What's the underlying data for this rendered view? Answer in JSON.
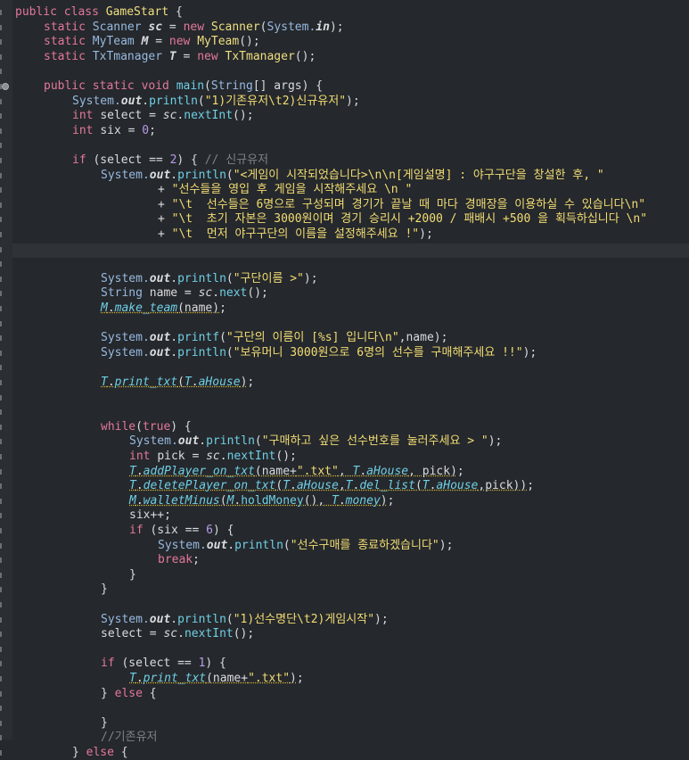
{
  "theme": {
    "background": "#25282c",
    "keyword": "#e2789b",
    "type": "#97b9e0",
    "class": "#f0df82",
    "method": "#6fcfe6",
    "string": "#f2dd74",
    "comment": "#7e8286",
    "number": "#b79be6",
    "plain": "#d9dcdf"
  },
  "lines": [
    {
      "indent": 0,
      "tokens": [
        {
          "t": "public class ",
          "c": "kw"
        },
        {
          "t": "GameStart ",
          "c": "cls"
        },
        {
          "t": "{",
          "c": "pl"
        }
      ]
    },
    {
      "indent": 1,
      "tokens": [
        {
          "t": "static ",
          "c": "kw"
        },
        {
          "t": "Scanner ",
          "c": "ty"
        },
        {
          "t": "sc",
          "c": "pl",
          "f": "it bd"
        },
        {
          "t": " = ",
          "c": "pl"
        },
        {
          "t": "new ",
          "c": "kw"
        },
        {
          "t": "Scanner",
          "c": "cls"
        },
        {
          "t": "(",
          "c": "pl"
        },
        {
          "t": "System.",
          "c": "ty"
        },
        {
          "t": "in",
          "c": "pl",
          "f": "it bd"
        },
        {
          "t": ");",
          "c": "pl"
        }
      ]
    },
    {
      "indent": 1,
      "tokens": [
        {
          "t": "static ",
          "c": "kw"
        },
        {
          "t": "MyTeam ",
          "c": "ty"
        },
        {
          "t": "M",
          "c": "pl",
          "f": "it bd"
        },
        {
          "t": " = ",
          "c": "pl"
        },
        {
          "t": "new ",
          "c": "kw"
        },
        {
          "t": "MyTeam",
          "c": "cls"
        },
        {
          "t": "();",
          "c": "pl"
        }
      ]
    },
    {
      "indent": 1,
      "tokens": [
        {
          "t": "static ",
          "c": "kw"
        },
        {
          "t": "TxTmanager ",
          "c": "ty"
        },
        {
          "t": "T",
          "c": "pl",
          "f": "it bd"
        },
        {
          "t": " = ",
          "c": "pl"
        },
        {
          "t": "new ",
          "c": "kw"
        },
        {
          "t": "TxTmanager",
          "c": "cls"
        },
        {
          "t": "();",
          "c": "pl"
        }
      ]
    },
    {
      "indent": 0,
      "tokens": []
    },
    {
      "indent": 1,
      "tokens": [
        {
          "t": "public static void ",
          "c": "kw"
        },
        {
          "t": "main",
          "c": "fn"
        },
        {
          "t": "(",
          "c": "pl"
        },
        {
          "t": "String",
          "c": "ty"
        },
        {
          "t": "[] args) {",
          "c": "pl"
        }
      ]
    },
    {
      "indent": 2,
      "tokens": [
        {
          "t": "System.",
          "c": "ty"
        },
        {
          "t": "out",
          "c": "pl",
          "f": "it bd"
        },
        {
          "t": ".",
          "c": "pl"
        },
        {
          "t": "println",
          "c": "fn"
        },
        {
          "t": "(",
          "c": "pl"
        },
        {
          "t": "\"1)기존유저\\t2)신규유저\"",
          "c": "st"
        },
        {
          "t": ");",
          "c": "pl"
        }
      ]
    },
    {
      "indent": 2,
      "tokens": [
        {
          "t": "int ",
          "c": "kw"
        },
        {
          "t": "select = ",
          "c": "pl"
        },
        {
          "t": "sc",
          "c": "pl",
          "f": "it"
        },
        {
          "t": ".",
          "c": "pl"
        },
        {
          "t": "nextInt",
          "c": "fn"
        },
        {
          "t": "();",
          "c": "pl"
        }
      ]
    },
    {
      "indent": 2,
      "tokens": [
        {
          "t": "int ",
          "c": "kw"
        },
        {
          "t": "six = ",
          "c": "pl"
        },
        {
          "t": "0",
          "c": "nm"
        },
        {
          "t": ";",
          "c": "pl"
        }
      ]
    },
    {
      "indent": 0,
      "tokens": []
    },
    {
      "indent": 2,
      "tokens": [
        {
          "t": "if ",
          "c": "kw"
        },
        {
          "t": "(select == ",
          "c": "pl"
        },
        {
          "t": "2",
          "c": "nm"
        },
        {
          "t": ") { ",
          "c": "pl"
        },
        {
          "t": "// 신규유저",
          "c": "cm"
        }
      ]
    },
    {
      "indent": 3,
      "tokens": [
        {
          "t": "System.",
          "c": "ty"
        },
        {
          "t": "out",
          "c": "pl",
          "f": "it bd"
        },
        {
          "t": ".",
          "c": "pl"
        },
        {
          "t": "println",
          "c": "fn"
        },
        {
          "t": "(",
          "c": "pl"
        },
        {
          "t": "\"<게임이 시작되었습니다>\\n\\n[게임설명] : 야구구단을 창설한 후, \"",
          "c": "st"
        }
      ]
    },
    {
      "indent": 5,
      "tokens": [
        {
          "t": "+ ",
          "c": "pl"
        },
        {
          "t": "\"선수들을 영입 후 게임을 시작해주세요 \\n \"",
          "c": "st"
        }
      ]
    },
    {
      "indent": 5,
      "tokens": [
        {
          "t": "+ ",
          "c": "pl"
        },
        {
          "t": "\"\\t  선수들은 6명으로 구성되며 경기가 끝날 때 마다 경매장을 이용하실 수 있습니다\\n\"",
          "c": "st"
        }
      ]
    },
    {
      "indent": 5,
      "tokens": [
        {
          "t": "+ ",
          "c": "pl"
        },
        {
          "t": "\"\\t  초기 자본은 3000원이며 경기 승리시 +2000 / 패배시 +500 을 획득하십니다 \\n\"",
          "c": "st"
        }
      ]
    },
    {
      "indent": 5,
      "tokens": [
        {
          "t": "+ ",
          "c": "pl"
        },
        {
          "t": "\"\\t  먼저 야구구단의 이름을 설정해주세요 !\"",
          "c": "st"
        },
        {
          "t": ");",
          "c": "pl"
        }
      ]
    },
    {
      "indent": 0,
      "tokens": []
    },
    {
      "indent": 0,
      "tokens": []
    },
    {
      "indent": 3,
      "tokens": [
        {
          "t": "System.",
          "c": "ty"
        },
        {
          "t": "out",
          "c": "pl",
          "f": "it bd"
        },
        {
          "t": ".",
          "c": "pl"
        },
        {
          "t": "println",
          "c": "fn"
        },
        {
          "t": "(",
          "c": "pl"
        },
        {
          "t": "\"구단이름 >\"",
          "c": "st"
        },
        {
          "t": ");",
          "c": "pl"
        }
      ]
    },
    {
      "indent": 3,
      "tokens": [
        {
          "t": "String ",
          "c": "ty"
        },
        {
          "t": "name = ",
          "c": "pl"
        },
        {
          "t": "sc",
          "c": "pl",
          "f": "it"
        },
        {
          "t": ".",
          "c": "pl"
        },
        {
          "t": "next",
          "c": "fn"
        },
        {
          "t": "();",
          "c": "pl"
        }
      ]
    },
    {
      "indent": 3,
      "tokens": [
        {
          "t": "M",
          "c": "fn",
          "f": "it ul"
        },
        {
          "t": ".",
          "c": "pl",
          "f": "ul"
        },
        {
          "t": "make_team",
          "c": "fn",
          "f": "it ul"
        },
        {
          "t": "(name)",
          "c": "pl",
          "f": "ul"
        },
        {
          "t": ";",
          "c": "pl"
        }
      ]
    },
    {
      "indent": 0,
      "tokens": []
    },
    {
      "indent": 3,
      "tokens": [
        {
          "t": "System.",
          "c": "ty"
        },
        {
          "t": "out",
          "c": "pl",
          "f": "it bd"
        },
        {
          "t": ".",
          "c": "pl"
        },
        {
          "t": "printf",
          "c": "fn"
        },
        {
          "t": "(",
          "c": "pl"
        },
        {
          "t": "\"구단의 이름이 [%s] 입니다\\n\"",
          "c": "st"
        },
        {
          "t": ",name);",
          "c": "pl"
        }
      ]
    },
    {
      "indent": 3,
      "tokens": [
        {
          "t": "System.",
          "c": "ty"
        },
        {
          "t": "out",
          "c": "pl",
          "f": "it bd"
        },
        {
          "t": ".",
          "c": "pl"
        },
        {
          "t": "println",
          "c": "fn"
        },
        {
          "t": "(",
          "c": "pl"
        },
        {
          "t": "\"보유머니 3000원으로 6명의 선수를 구매해주세요 !!\"",
          "c": "st"
        },
        {
          "t": ");",
          "c": "pl"
        }
      ]
    },
    {
      "indent": 0,
      "tokens": []
    },
    {
      "indent": 3,
      "tokens": [
        {
          "t": "T",
          "c": "fn",
          "f": "it ul"
        },
        {
          "t": ".",
          "c": "pl",
          "f": "ul"
        },
        {
          "t": "print_txt",
          "c": "fn",
          "f": "it ul"
        },
        {
          "t": "(",
          "c": "pl",
          "f": "ul"
        },
        {
          "t": "T",
          "c": "fn",
          "f": "it ul"
        },
        {
          "t": ".",
          "c": "pl",
          "f": "ul"
        },
        {
          "t": "aHouse",
          "c": "fn",
          "f": "it ul"
        },
        {
          "t": ")",
          "c": "pl",
          "f": "ul"
        },
        {
          "t": ";",
          "c": "pl"
        }
      ]
    },
    {
      "indent": 0,
      "tokens": []
    },
    {
      "indent": 0,
      "tokens": []
    },
    {
      "indent": 3,
      "tokens": [
        {
          "t": "while",
          "c": "kw"
        },
        {
          "t": "(",
          "c": "pl"
        },
        {
          "t": "true",
          "c": "kw"
        },
        {
          "t": ") {",
          "c": "pl"
        }
      ]
    },
    {
      "indent": 4,
      "tokens": [
        {
          "t": "System.",
          "c": "ty"
        },
        {
          "t": "out",
          "c": "pl",
          "f": "it bd"
        },
        {
          "t": ".",
          "c": "pl"
        },
        {
          "t": "println",
          "c": "fn"
        },
        {
          "t": "(",
          "c": "pl"
        },
        {
          "t": "\"구매하고 싶은 선수번호를 눌러주세요 > \"",
          "c": "st"
        },
        {
          "t": ");",
          "c": "pl"
        }
      ]
    },
    {
      "indent": 4,
      "tokens": [
        {
          "t": "int ",
          "c": "kw"
        },
        {
          "t": "pick = ",
          "c": "pl"
        },
        {
          "t": "sc",
          "c": "pl",
          "f": "it"
        },
        {
          "t": ".",
          "c": "pl"
        },
        {
          "t": "nextInt",
          "c": "fn"
        },
        {
          "t": "();",
          "c": "pl"
        }
      ]
    },
    {
      "indent": 4,
      "tokens": [
        {
          "t": "T",
          "c": "fn",
          "f": "it ul"
        },
        {
          "t": ".",
          "c": "pl",
          "f": "ul"
        },
        {
          "t": "addPlayer_on_txt",
          "c": "fn",
          "f": "it ul"
        },
        {
          "t": "(name+",
          "c": "pl",
          "f": "ul"
        },
        {
          "t": "\".txt\"",
          "c": "st",
          "f": "ul"
        },
        {
          "t": ", ",
          "c": "pl",
          "f": "ul"
        },
        {
          "t": "T",
          "c": "fn",
          "f": "it ul"
        },
        {
          "t": ".",
          "c": "pl",
          "f": "ul"
        },
        {
          "t": "aHouse",
          "c": "fn",
          "f": "it ul"
        },
        {
          "t": ", pick)",
          "c": "pl",
          "f": "ul"
        },
        {
          "t": ";",
          "c": "pl"
        }
      ]
    },
    {
      "indent": 4,
      "tokens": [
        {
          "t": "T",
          "c": "fn",
          "f": "it ul"
        },
        {
          "t": ".",
          "c": "pl",
          "f": "ul"
        },
        {
          "t": "deletePlayer_on_txt",
          "c": "fn",
          "f": "it ul"
        },
        {
          "t": "(",
          "c": "pl",
          "f": "ul"
        },
        {
          "t": "T",
          "c": "fn",
          "f": "it ul"
        },
        {
          "t": ".",
          "c": "pl",
          "f": "ul"
        },
        {
          "t": "aHouse",
          "c": "fn",
          "f": "it ul"
        },
        {
          "t": ",",
          "c": "pl",
          "f": "ul"
        },
        {
          "t": "T",
          "c": "fn",
          "f": "it ul"
        },
        {
          "t": ".",
          "c": "pl",
          "f": "ul"
        },
        {
          "t": "del_list",
          "c": "fn",
          "f": "it ul"
        },
        {
          "t": "(",
          "c": "pl",
          "f": "ul"
        },
        {
          "t": "T",
          "c": "fn",
          "f": "it ul"
        },
        {
          "t": ".",
          "c": "pl",
          "f": "ul"
        },
        {
          "t": "aHouse",
          "c": "fn",
          "f": "it ul"
        },
        {
          "t": ",pick))",
          "c": "pl",
          "f": "ul"
        },
        {
          "t": ";",
          "c": "pl"
        }
      ]
    },
    {
      "indent": 4,
      "tokens": [
        {
          "t": "M",
          "c": "fn",
          "f": "it ul"
        },
        {
          "t": ".",
          "c": "pl",
          "f": "ul"
        },
        {
          "t": "walletMinus",
          "c": "fn",
          "f": "it ul"
        },
        {
          "t": "(",
          "c": "pl",
          "f": "ul"
        },
        {
          "t": "M",
          "c": "fn",
          "f": "it ul"
        },
        {
          "t": ".",
          "c": "pl",
          "f": "ul"
        },
        {
          "t": "holdMoney",
          "c": "fn",
          "f": "ul"
        },
        {
          "t": "(), ",
          "c": "pl",
          "f": "ul"
        },
        {
          "t": "T",
          "c": "fn",
          "f": "it ul"
        },
        {
          "t": ".",
          "c": "pl",
          "f": "ul"
        },
        {
          "t": "money",
          "c": "fn",
          "f": "it ul"
        },
        {
          "t": ")",
          "c": "pl",
          "f": "ul"
        },
        {
          "t": ";",
          "c": "pl"
        }
      ]
    },
    {
      "indent": 4,
      "tokens": [
        {
          "t": "six++;",
          "c": "pl"
        }
      ]
    },
    {
      "indent": 4,
      "tokens": [
        {
          "t": "if ",
          "c": "kw"
        },
        {
          "t": "(six == ",
          "c": "pl"
        },
        {
          "t": "6",
          "c": "nm"
        },
        {
          "t": ") {",
          "c": "pl"
        }
      ]
    },
    {
      "indent": 5,
      "tokens": [
        {
          "t": "System.",
          "c": "ty"
        },
        {
          "t": "out",
          "c": "pl",
          "f": "it bd"
        },
        {
          "t": ".",
          "c": "pl"
        },
        {
          "t": "println",
          "c": "fn"
        },
        {
          "t": "(",
          "c": "pl"
        },
        {
          "t": "\"선수구매를 종료하겠습니다\"",
          "c": "st"
        },
        {
          "t": ");",
          "c": "pl"
        }
      ]
    },
    {
      "indent": 5,
      "tokens": [
        {
          "t": "break",
          "c": "kw"
        },
        {
          "t": ";",
          "c": "pl"
        }
      ]
    },
    {
      "indent": 4,
      "tokens": [
        {
          "t": "}",
          "c": "pl"
        }
      ]
    },
    {
      "indent": 3,
      "tokens": [
        {
          "t": "}",
          "c": "pl"
        }
      ]
    },
    {
      "indent": 0,
      "tokens": []
    },
    {
      "indent": 3,
      "tokens": [
        {
          "t": "System.",
          "c": "ty"
        },
        {
          "t": "out",
          "c": "pl",
          "f": "it bd"
        },
        {
          "t": ".",
          "c": "pl"
        },
        {
          "t": "println",
          "c": "fn"
        },
        {
          "t": "(",
          "c": "pl"
        },
        {
          "t": "\"1)선수명단\\t2)게임시작\"",
          "c": "st"
        },
        {
          "t": ");",
          "c": "pl"
        }
      ]
    },
    {
      "indent": 3,
      "tokens": [
        {
          "t": "select = ",
          "c": "pl"
        },
        {
          "t": "sc",
          "c": "pl",
          "f": "it"
        },
        {
          "t": ".",
          "c": "pl"
        },
        {
          "t": "nextInt",
          "c": "fn"
        },
        {
          "t": "();",
          "c": "pl"
        }
      ]
    },
    {
      "indent": 0,
      "tokens": []
    },
    {
      "indent": 3,
      "tokens": [
        {
          "t": "if ",
          "c": "kw"
        },
        {
          "t": "(select == ",
          "c": "pl"
        },
        {
          "t": "1",
          "c": "nm"
        },
        {
          "t": ") {",
          "c": "pl"
        }
      ]
    },
    {
      "indent": 4,
      "tokens": [
        {
          "t": "T",
          "c": "fn",
          "f": "it ul"
        },
        {
          "t": ".",
          "c": "pl",
          "f": "ul"
        },
        {
          "t": "print_txt",
          "c": "fn",
          "f": "it ul"
        },
        {
          "t": "(name+",
          "c": "pl",
          "f": "ul"
        },
        {
          "t": "\".txt\"",
          "c": "st",
          "f": "ul"
        },
        {
          "t": ")",
          "c": "pl",
          "f": "ul"
        },
        {
          "t": ";",
          "c": "pl"
        }
      ]
    },
    {
      "indent": 3,
      "tokens": [
        {
          "t": "} ",
          "c": "pl"
        },
        {
          "t": "else ",
          "c": "kw"
        },
        {
          "t": "{",
          "c": "pl"
        }
      ]
    },
    {
      "indent": 0,
      "tokens": []
    },
    {
      "indent": 3,
      "tokens": [
        {
          "t": "}",
          "c": "pl"
        }
      ]
    },
    {
      "indent": 3,
      "tokens": [
        {
          "t": "//기존유저",
          "c": "cm"
        }
      ]
    },
    {
      "indent": 2,
      "tokens": [
        {
          "t": "} ",
          "c": "pl"
        },
        {
          "t": "else ",
          "c": "kw"
        },
        {
          "t": "{",
          "c": "pl"
        }
      ]
    }
  ]
}
